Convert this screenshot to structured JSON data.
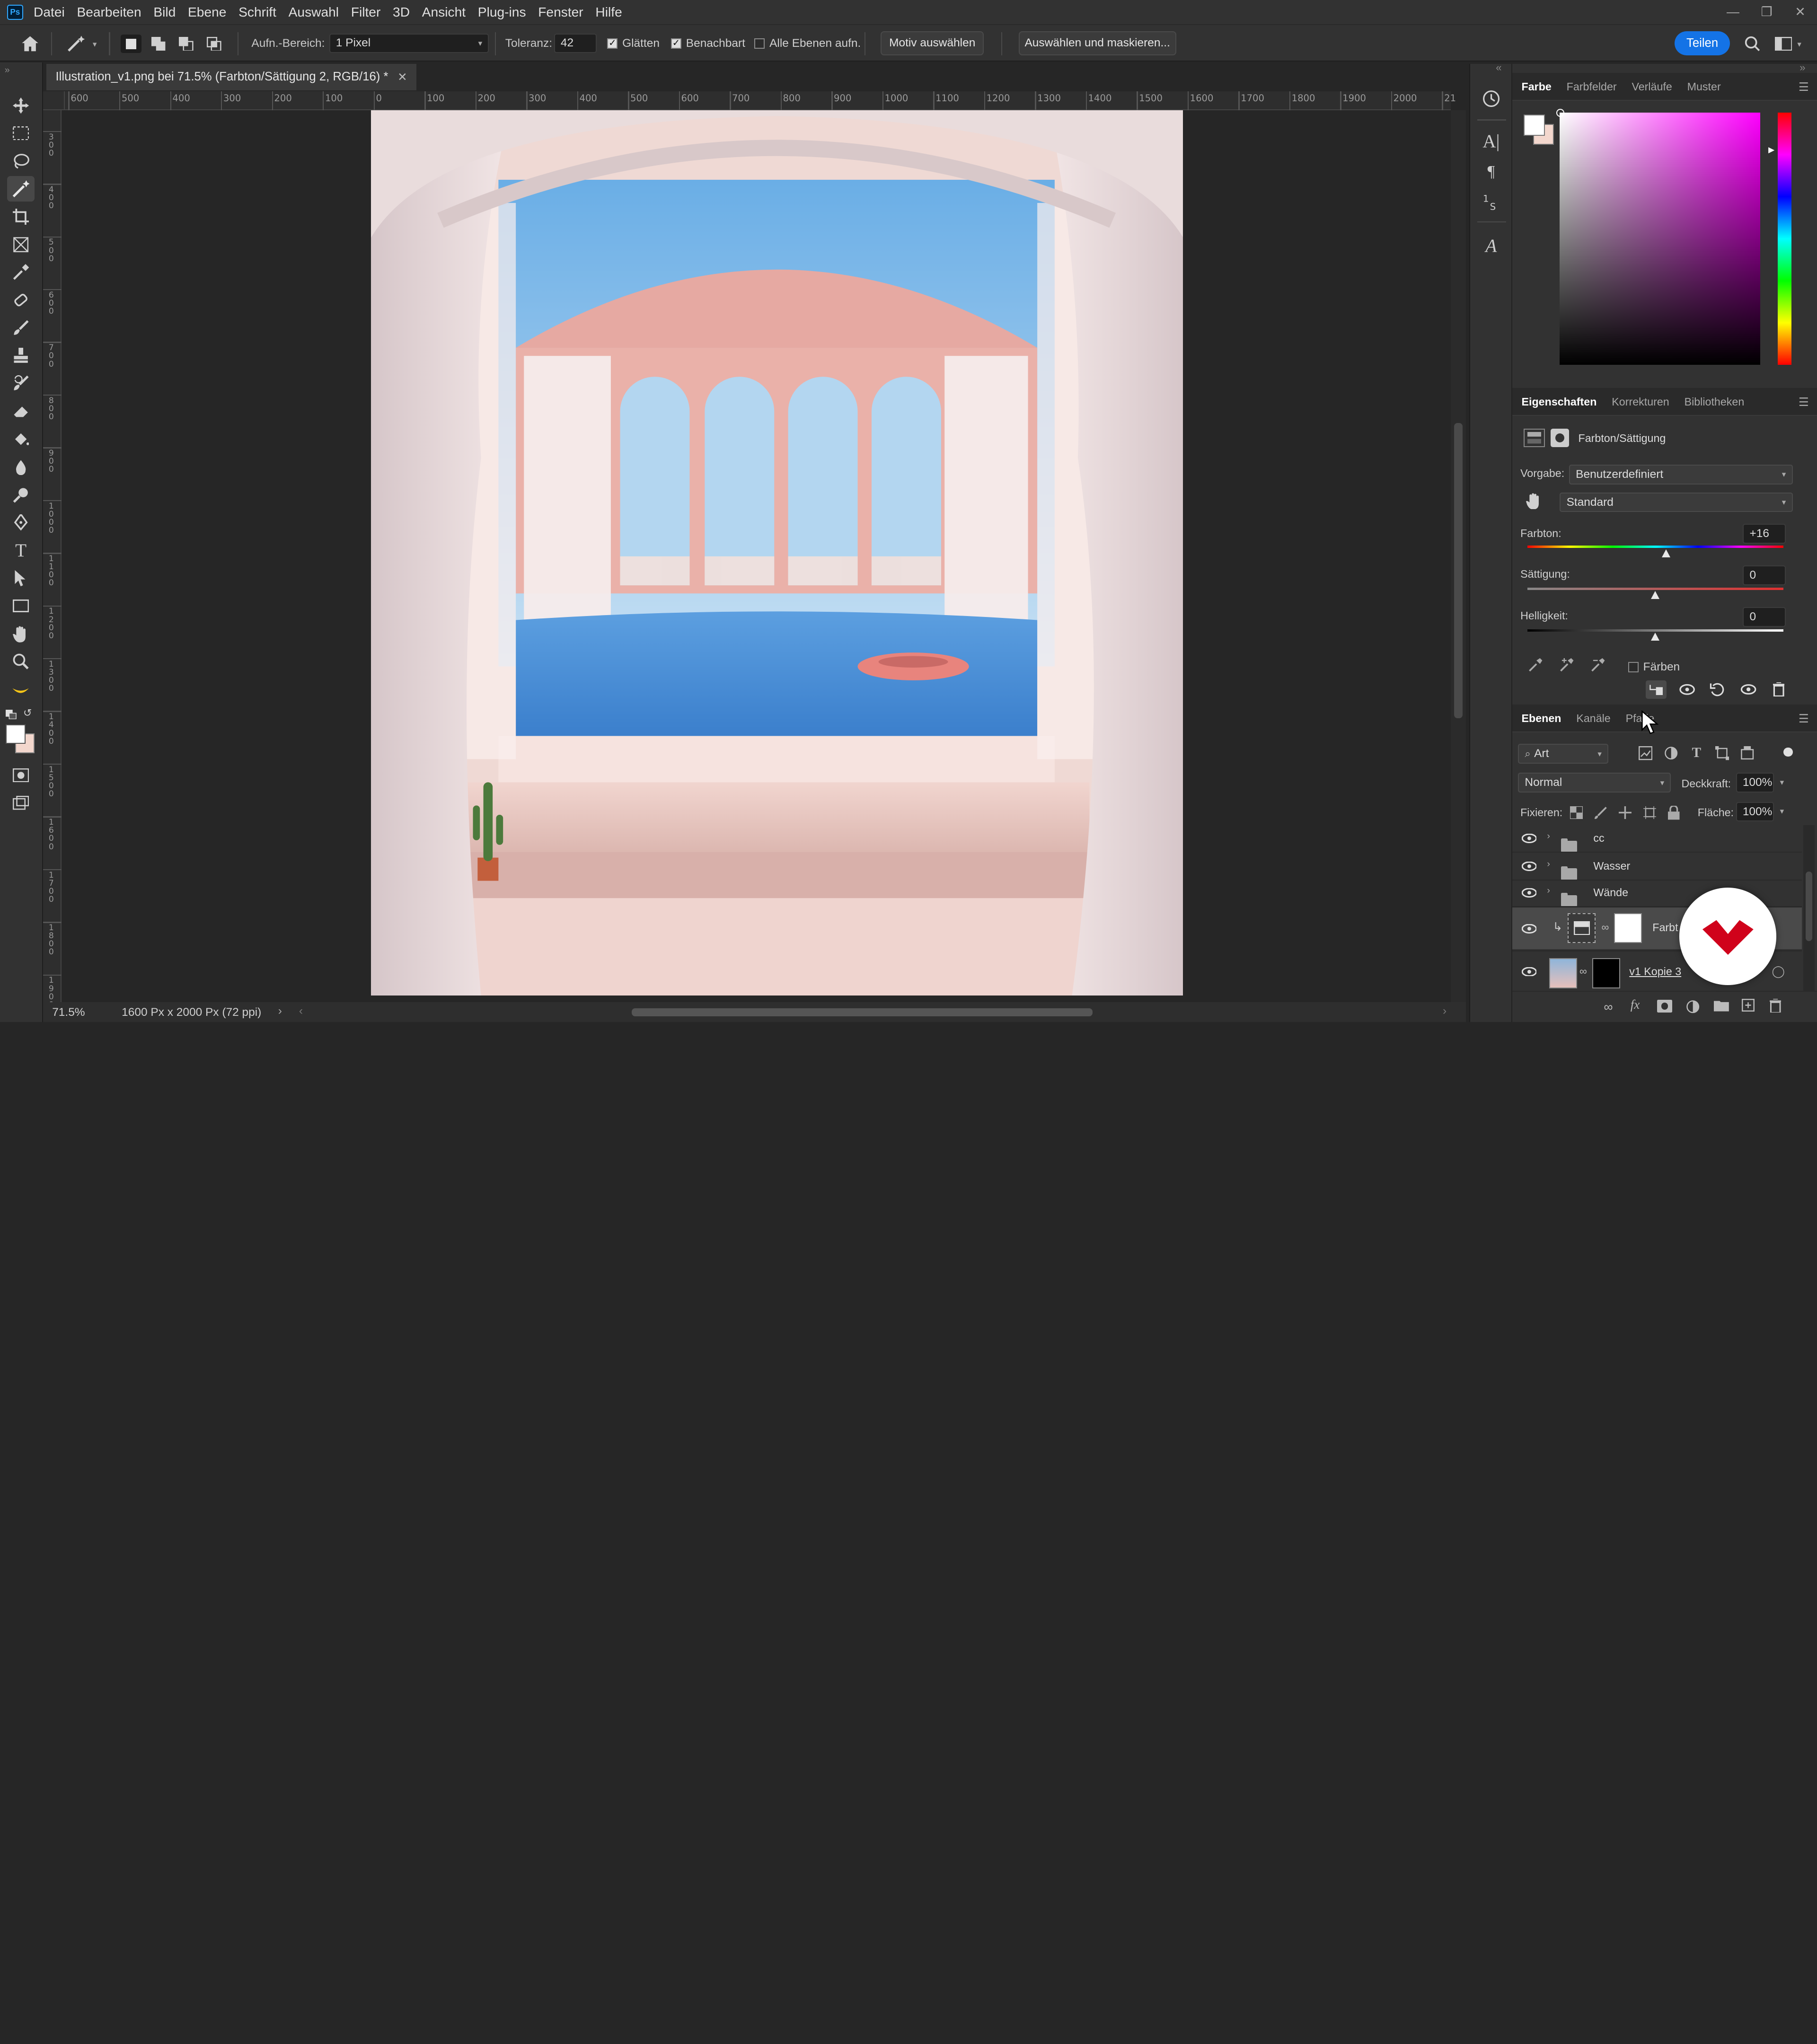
{
  "menu": [
    "Datei",
    "Bearbeiten",
    "Bild",
    "Ebene",
    "Schrift",
    "Auswahl",
    "Filter",
    "3D",
    "Ansicht",
    "Plug-ins",
    "Fenster",
    "Hilfe"
  ],
  "app_logo": "Ps",
  "options": {
    "sample_label": "Aufn.-Bereich:",
    "sample_value": "1 Pixel",
    "tolerance_label": "Toleranz:",
    "tolerance_value": "42",
    "antialias_label": "Glätten",
    "antialias_checked": true,
    "contiguous_label": "Benachbart",
    "contiguous_checked": true,
    "all_layers_label": "Alle Ebenen aufn.",
    "all_layers_checked": false,
    "select_subject_label": "Motiv auswählen",
    "select_mask_label": "Auswählen und maskieren...",
    "share_label": "Teilen"
  },
  "document": {
    "tab_title": "Illustration_v1.png bei 71.5% (Farbton/Sättigung 2, RGB/16) *",
    "zoom": "71.5%",
    "doc_info": "1600 Px x 2000 Px (72 ppi)"
  },
  "ruler": {
    "h_ticks": [
      "600",
      "500",
      "400",
      "300",
      "200",
      "100",
      "0",
      "100",
      "200",
      "300",
      "400",
      "500",
      "600",
      "700",
      "800",
      "900",
      "1000",
      "1100",
      "1200",
      "1300",
      "1400",
      "1500",
      "1600",
      "1700",
      "1800",
      "1900",
      "2000",
      "21"
    ],
    "v_ticks": [
      "3\n0\n0",
      "4\n0\n0",
      "5\n0\n0",
      "6\n0\n0",
      "7\n0\n0",
      "8\n0\n0",
      "9\n0\n0",
      "1\n0\n0\n0",
      "1\n1\n0\n0",
      "1\n2\n0\n0",
      "1\n3\n0\n0",
      "1\n4\n0\n0",
      "1\n5\n0\n0",
      "1\n6\n0\n0",
      "1\n7\n0\n0",
      "1\n8\n0\n0",
      "1\n9\n0\n0"
    ]
  },
  "color_panel": {
    "tabs": [
      "Farbe",
      "Farbfelder",
      "Verläufe",
      "Muster"
    ],
    "active_tab": "Farbe",
    "hue_color": "#ff00ff"
  },
  "properties_panel": {
    "tabs": [
      "Eigenschaften",
      "Korrekturen",
      "Bibliotheken"
    ],
    "active_tab": "Eigenschaften",
    "adjustment_name": "Farbton/Sättigung",
    "preset_label": "Vorgabe:",
    "preset_value": "Benutzerdefiniert",
    "channel_value": "Standard",
    "hue_label": "Farbton:",
    "hue_value": "+16",
    "hue_percent": 0.544,
    "saturation_label": "Sättigung:",
    "saturation_value": "0",
    "saturation_percent": 0.5,
    "lightness_label": "Helligkeit:",
    "lightness_value": "0",
    "lightness_percent": 0.5,
    "colorize_label": "Färben"
  },
  "layers_panel": {
    "tabs": [
      "Ebenen",
      "Kanäle",
      "Pfade"
    ],
    "active_tab": "Ebenen",
    "filter_value": "Art",
    "blend_mode": "Normal",
    "opacity_label": "Deckkraft:",
    "opacity_value": "100%",
    "lock_label": "Fixieren:",
    "fill_label": "Fläche:",
    "fill_value": "100%",
    "layers": [
      {
        "name": "cc",
        "type": "group"
      },
      {
        "name": "Wasser",
        "type": "group"
      },
      {
        "name": "Wände",
        "type": "group"
      },
      {
        "name": "Farbt",
        "type": "adjustment"
      },
      {
        "name": "v1 Kopie 3",
        "type": "image"
      }
    ]
  },
  "colors": {
    "accent": "#1473e6",
    "brand_red": "#d0021b"
  }
}
